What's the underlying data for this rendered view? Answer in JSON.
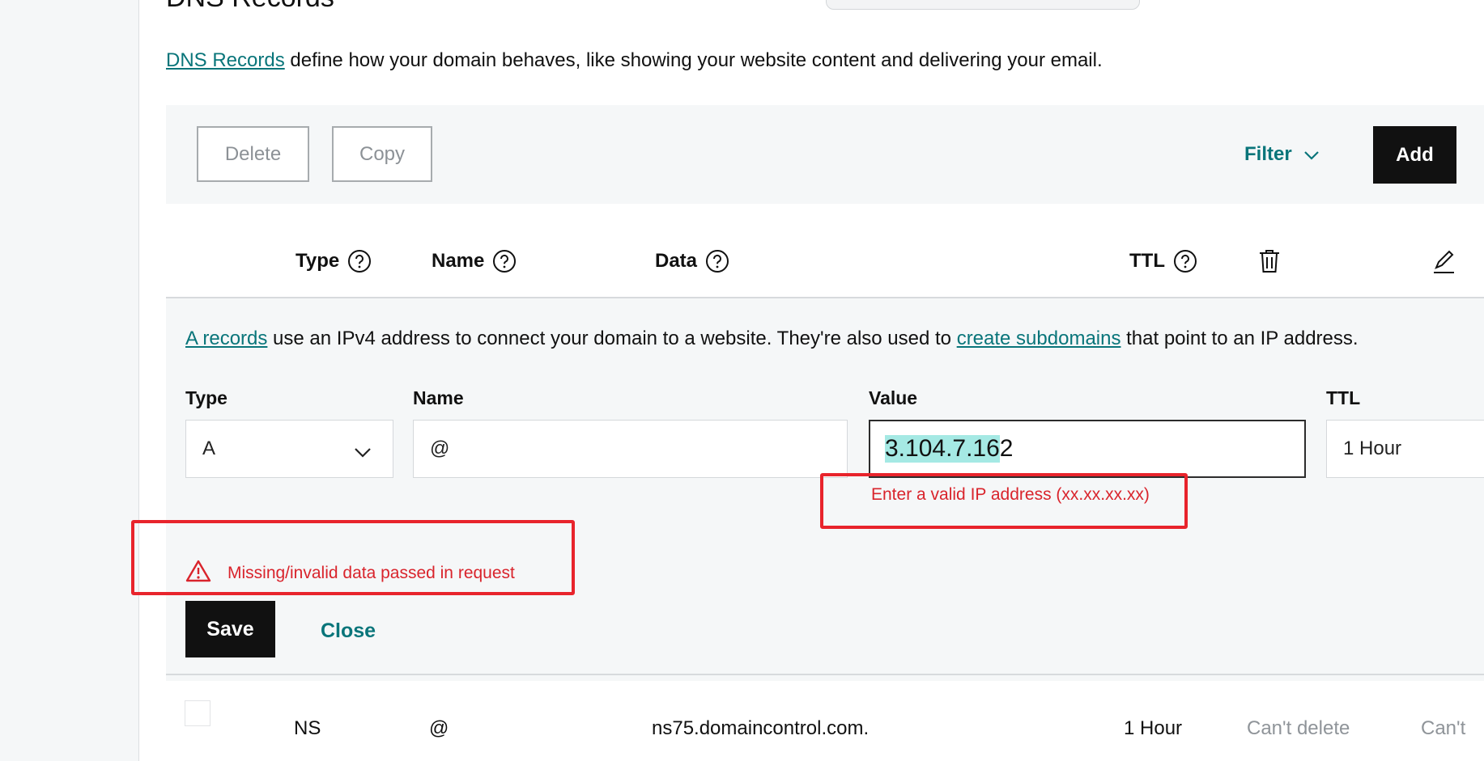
{
  "page": {
    "title": "DNS Records",
    "intro_link": "DNS Records",
    "intro_rest": " define how your domain behaves, like showing your website content and delivering your email."
  },
  "toolbar": {
    "delete_label": "Delete",
    "copy_label": "Copy",
    "filter_label": "Filter",
    "add_label": "Add"
  },
  "table": {
    "headers": {
      "type": "Type",
      "name": "Name",
      "data": "Data",
      "ttl": "TTL"
    }
  },
  "edit_form": {
    "note_link_1": "A records",
    "note_mid": " use an IPv4 address to connect your domain to a website. They're also used to ",
    "note_link_2": "create subdomains",
    "note_end": " that point to an IP address.",
    "type_label": "Type",
    "type_value": "A",
    "name_label": "Name",
    "name_value": "@",
    "value_label": "Value",
    "value_highlighted": "3.104.7.16",
    "value_rest": "2",
    "ttl_label": "TTL",
    "ttl_value": "1 Hour",
    "value_error": "Enter a valid IP address (xx.xx.xx.xx)",
    "request_error": "Missing/invalid data passed in request",
    "save_label": "Save",
    "close_label": "Close"
  },
  "records": [
    {
      "type": "NS",
      "name": "@",
      "data": "ns75.domaincontrol.com.",
      "ttl": "1 Hour",
      "delete_status": "Can't delete",
      "edit_status": "Can't"
    }
  ],
  "colors": {
    "accent": "#09757a",
    "error": "#d9242c",
    "annotation_box": "#e8242c",
    "highlight": "#a5e9e4",
    "panel_bg": "#f5f7f8"
  }
}
